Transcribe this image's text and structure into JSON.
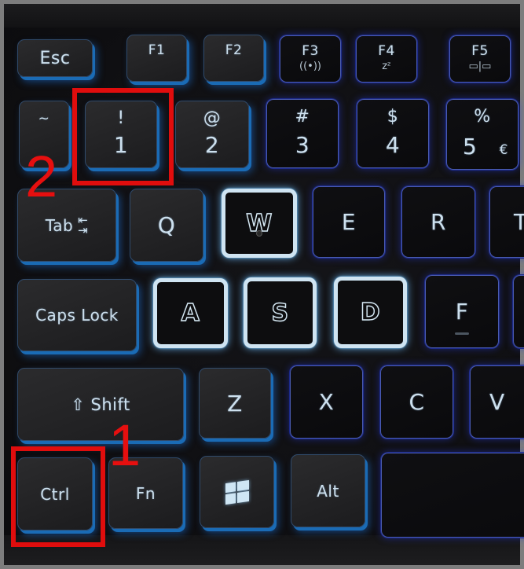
{
  "scene": {
    "description": "Backlit laptop keyboard (left section) with red annotation boxes",
    "backlight_color": "#2f6dff",
    "highlight_key_border_color": "#cfe4f2",
    "annotation_color": "#e00d0d"
  },
  "rows": {
    "function_row": [
      {
        "id": "esc",
        "label": "Esc"
      },
      {
        "id": "f1",
        "label": "F1"
      },
      {
        "id": "f2",
        "label": "F2"
      },
      {
        "id": "f3",
        "label": "F3",
        "icon": "wireless-icon",
        "glyph": "((•))"
      },
      {
        "id": "f4",
        "label": "F4",
        "icon": "sleep-icon",
        "glyph": "zᶻ"
      },
      {
        "id": "f5",
        "label": "F5",
        "icon": "display-switch-icon",
        "glyph": "▭|▭"
      }
    ],
    "number_row": [
      {
        "id": "tilde",
        "top": "~",
        "bottom": ""
      },
      {
        "id": "1",
        "top": "!",
        "bottom": "1"
      },
      {
        "id": "2",
        "top": "@",
        "bottom": "2"
      },
      {
        "id": "3",
        "top": "#",
        "bottom": "3"
      },
      {
        "id": "4",
        "top": "$",
        "bottom": "4"
      },
      {
        "id": "5",
        "top": "%",
        "bottom": "5",
        "extra": "€"
      }
    ],
    "qwerty_row": [
      {
        "id": "tab",
        "label": "Tab",
        "icon": "tab-arrows-icon",
        "glyph": "⇤\n⇥"
      },
      {
        "id": "q",
        "label": "Q"
      },
      {
        "id": "w",
        "label": "W",
        "highlighted": true
      },
      {
        "id": "e",
        "label": "E"
      },
      {
        "id": "r",
        "label": "R"
      },
      {
        "id": "t",
        "label": "T",
        "partial": true
      }
    ],
    "home_row": [
      {
        "id": "capslock",
        "label": "Caps Lock"
      },
      {
        "id": "a",
        "label": "A",
        "highlighted": true
      },
      {
        "id": "s",
        "label": "S",
        "highlighted": true
      },
      {
        "id": "d",
        "label": "D",
        "highlighted": true
      },
      {
        "id": "f",
        "label": "F"
      },
      {
        "id": "g",
        "label": "",
        "partial": true
      }
    ],
    "shift_row": [
      {
        "id": "shift",
        "label": "⇧ Shift"
      },
      {
        "id": "z",
        "label": "Z"
      },
      {
        "id": "x",
        "label": "X"
      },
      {
        "id": "c",
        "label": "C"
      },
      {
        "id": "v",
        "label": "V",
        "partial": true
      }
    ],
    "bottom_row": [
      {
        "id": "ctrl",
        "label": "Ctrl"
      },
      {
        "id": "fn",
        "label": "Fn"
      },
      {
        "id": "win",
        "label": "",
        "icon": "windows-logo-icon"
      },
      {
        "id": "alt",
        "label": "Alt"
      },
      {
        "id": "space",
        "label": ""
      }
    ]
  },
  "annotations": [
    {
      "number": "1",
      "target": "Ctrl"
    },
    {
      "number": "2",
      "target": "! 1"
    }
  ]
}
